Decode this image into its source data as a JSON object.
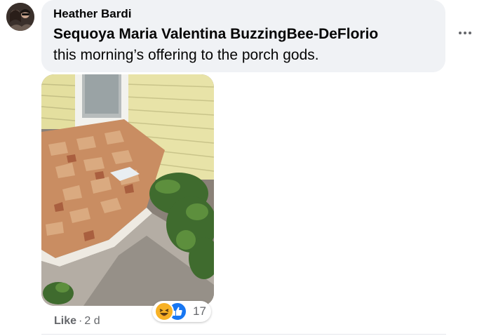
{
  "comment": {
    "author": "Heather Bardi",
    "mention": "Sequoya Maria Valentina BuzzingBee-DeFlorio",
    "text": "this morning’s offering to the porch gods."
  },
  "reactions": {
    "icons": [
      "haha-emoji-icon",
      "like-thumb-icon"
    ],
    "count": "17"
  },
  "actions": {
    "like_label": "Like",
    "separator": "·",
    "timestamp": "2 d"
  },
  "colors": {
    "bubble": "#f0f2f5",
    "secondary_text": "#65676b",
    "like_blue": "#1877f2",
    "haha_yellow": "#f7b125"
  }
}
